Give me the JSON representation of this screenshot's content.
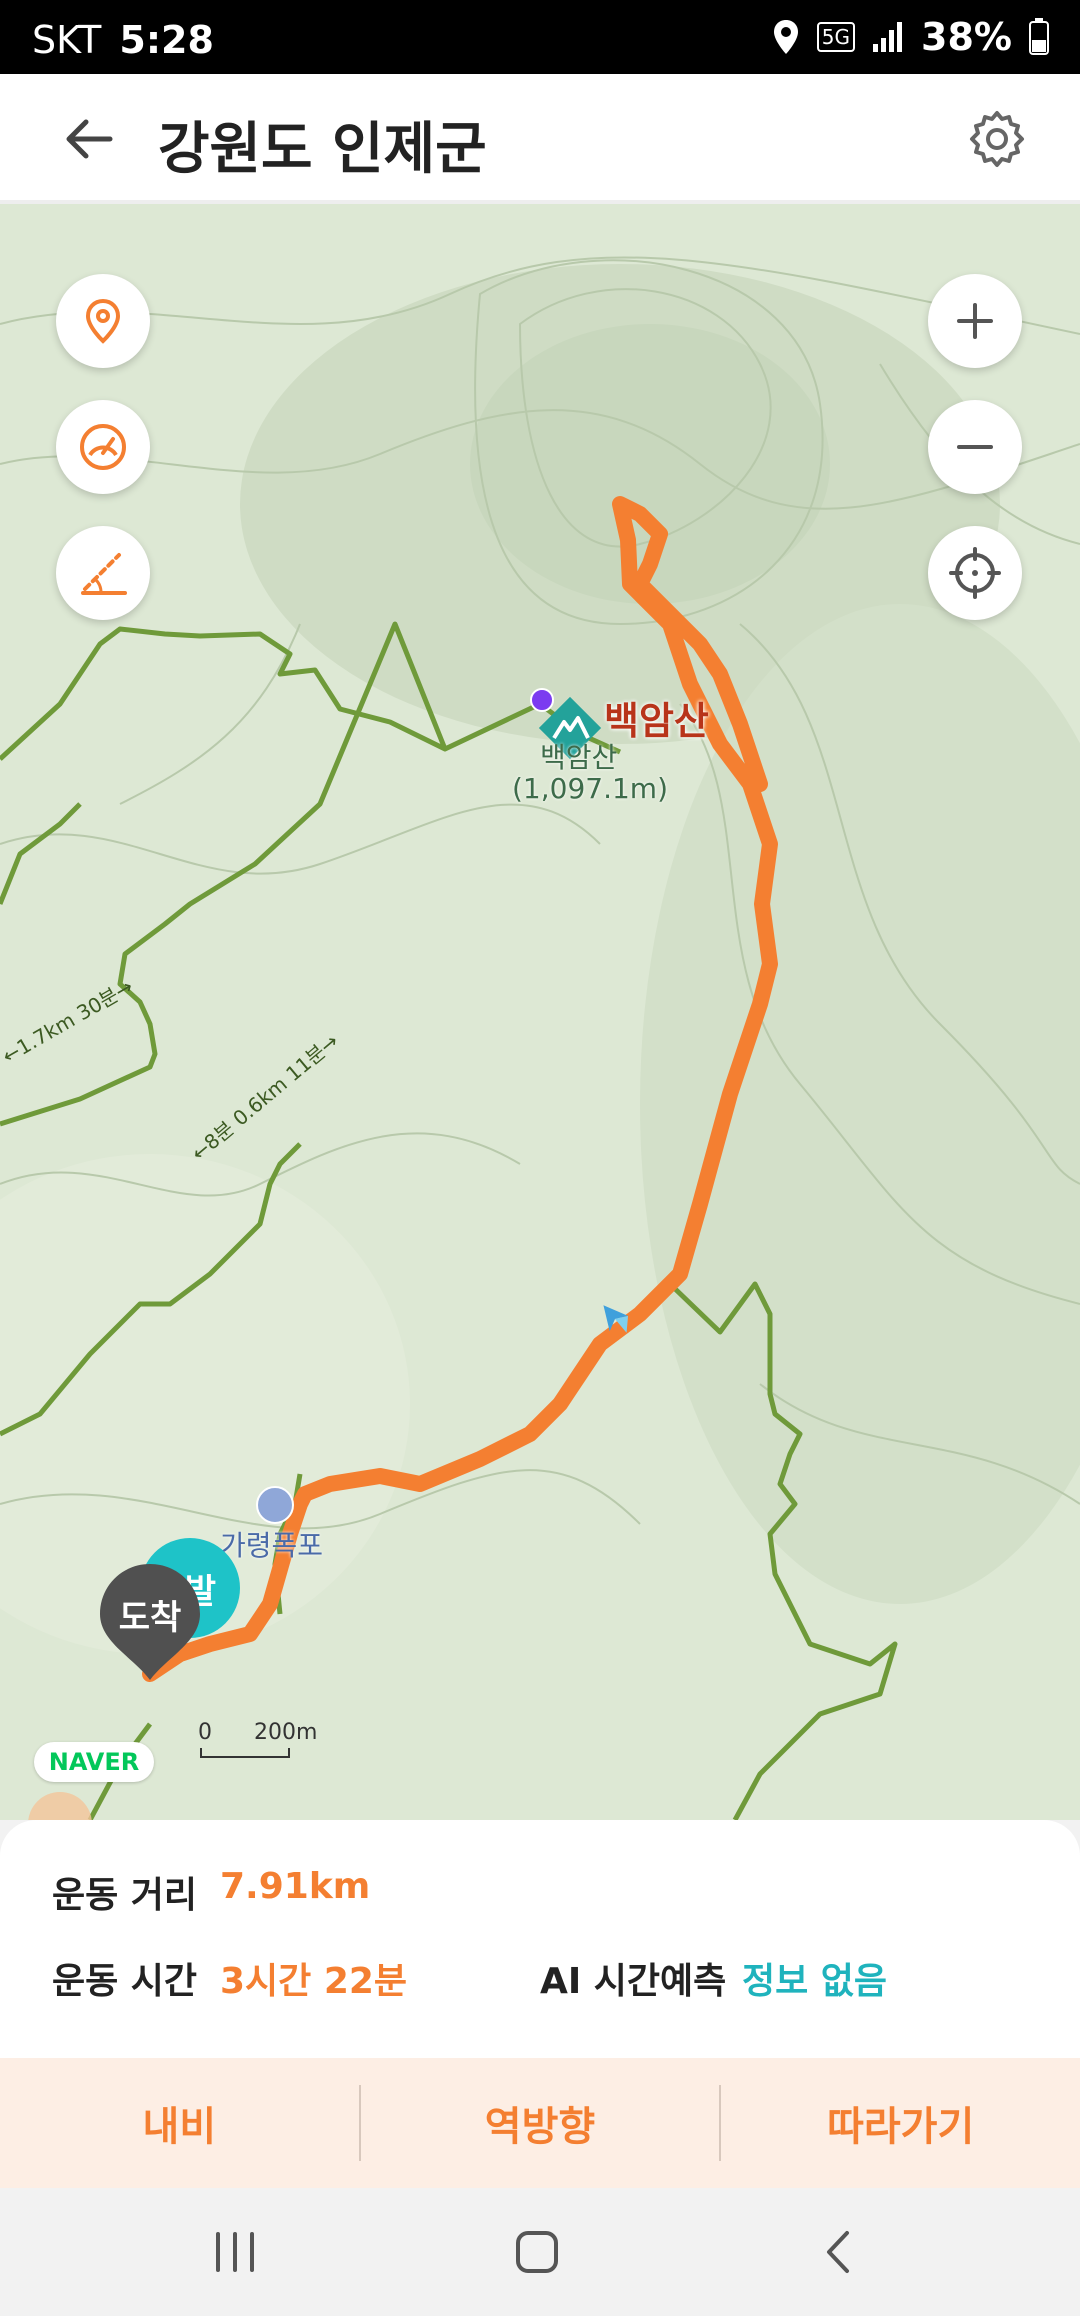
{
  "status": {
    "carrier": "SKT",
    "time": "5:28",
    "battery": "38%",
    "network": "5G"
  },
  "header": {
    "title": "강원도 인제군"
  },
  "map": {
    "peak_name": "백암산",
    "peak_label": "백암산",
    "peak_elevation": "(1,097.1m)",
    "place_label": "가령폭포",
    "trail_label_1": "←1.7km 30분→",
    "trail_label_2": "←8분 0.6km 11분→",
    "start_marker": "발",
    "end_marker": "도착",
    "naver": "NAVER",
    "scale_zero": "0",
    "scale_value": "200m",
    "route_color": "#f47f31",
    "trail_color": "#6f9a3a"
  },
  "info": {
    "distance_label": "운동 거리",
    "distance_value": "7.91km",
    "time_label": "운동 시간",
    "time_value": "3시간 22분",
    "ai_label": "AI 시간예측",
    "ai_value": "정보 없음"
  },
  "actions": {
    "navi": "내비",
    "reverse": "역방향",
    "follow": "따라가기"
  }
}
